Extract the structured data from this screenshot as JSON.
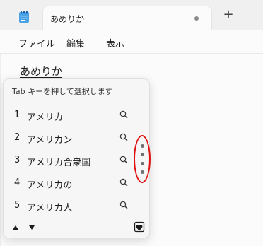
{
  "tab": {
    "title": "あめりか",
    "new_tab_glyph": "+"
  },
  "menu": [
    {
      "id": "file",
      "label": "ファイル"
    },
    {
      "id": "edit",
      "label": "編集"
    },
    {
      "id": "view",
      "label": "表示"
    }
  ],
  "editor": {
    "composition_text": "あめりか"
  },
  "ime": {
    "hint": "Tab キーを押して選択します",
    "candidates": [
      {
        "num": "1",
        "text": "アメリカ"
      },
      {
        "num": "2",
        "text": "アメリカン"
      },
      {
        "num": "3",
        "text": "アメリカ合衆国"
      },
      {
        "num": "4",
        "text": "アメリカの"
      },
      {
        "num": "5",
        "text": "アメリカ人"
      }
    ]
  },
  "colors": {
    "highlight_ring": "#e01010",
    "tab_background": "#fbfbfb",
    "titlebar": "#f0f0f0"
  }
}
